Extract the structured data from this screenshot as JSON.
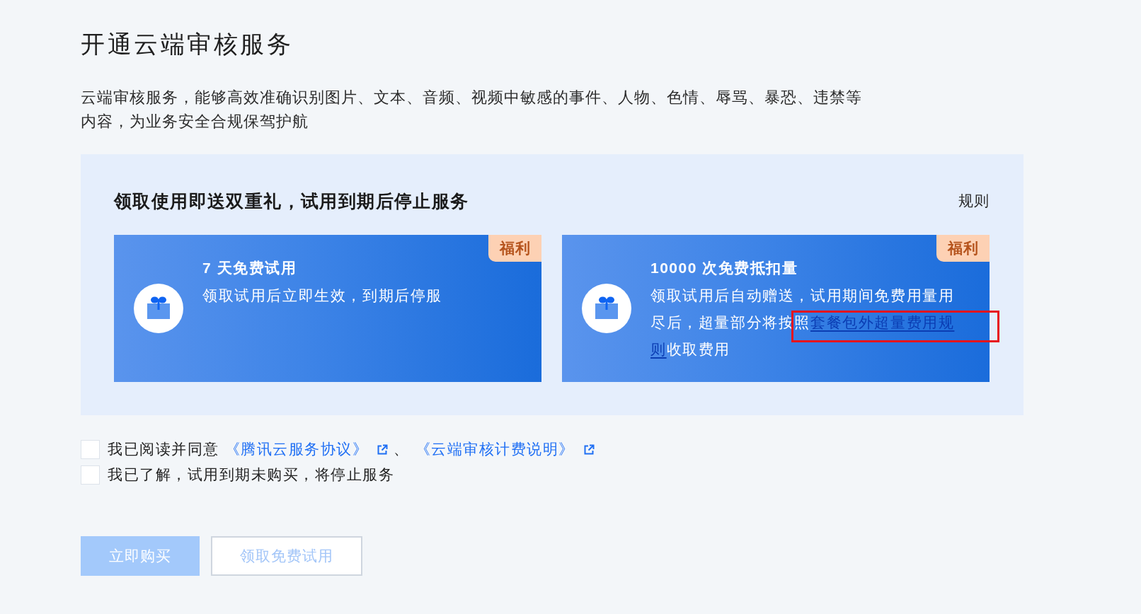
{
  "page": {
    "title": "开通云端审核服务",
    "description": "云端审核服务，能够高效准确识别图片、文本、音频、视频中敏感的事件、人物、色情、辱骂、暴恐、违禁等内容，为业务安全合规保驾护航"
  },
  "promo_panel": {
    "heading": "领取使用即送双重礼，试用到期后停止服务",
    "rules_link": "规则",
    "cards": [
      {
        "title": "7 天免费试用",
        "badge": "福利",
        "description": [
          {
            "kind": "text",
            "text": "领取试用后立即生效，到期后停服",
            "highlighted": false
          }
        ]
      },
      {
        "title": "10000 次免费抵扣量",
        "badge": "福利",
        "description": [
          {
            "kind": "text",
            "text": "领取试用后自动赠送，试用期间免费用量用尽后，超量部分将按照",
            "highlighted": false
          },
          {
            "kind": "link",
            "text": "套餐包外超量费用规",
            "highlighted": true
          },
          {
            "kind": "link",
            "text": "则",
            "highlighted": false
          },
          {
            "kind": "text",
            "text": "收取费用",
            "highlighted": false
          }
        ]
      }
    ]
  },
  "agreements": [
    {
      "checked": false,
      "segments": [
        {
          "kind": "text",
          "text": "我已阅读并同意"
        },
        {
          "kind": "external_link",
          "text": "《腾讯云服务协议》"
        },
        {
          "kind": "text",
          "text": "、"
        },
        {
          "kind": "external_link",
          "text": "《云端审核计费说明》"
        }
      ]
    },
    {
      "checked": false,
      "segments": [
        {
          "kind": "text",
          "text": "我已了解，试用到期未购买，将停止服务"
        }
      ]
    }
  ],
  "buttons": [
    {
      "label": "立即购买",
      "kind": "primary",
      "disabled": true
    },
    {
      "label": "领取免费试用",
      "kind": "secondary",
      "disabled": true
    }
  ]
}
